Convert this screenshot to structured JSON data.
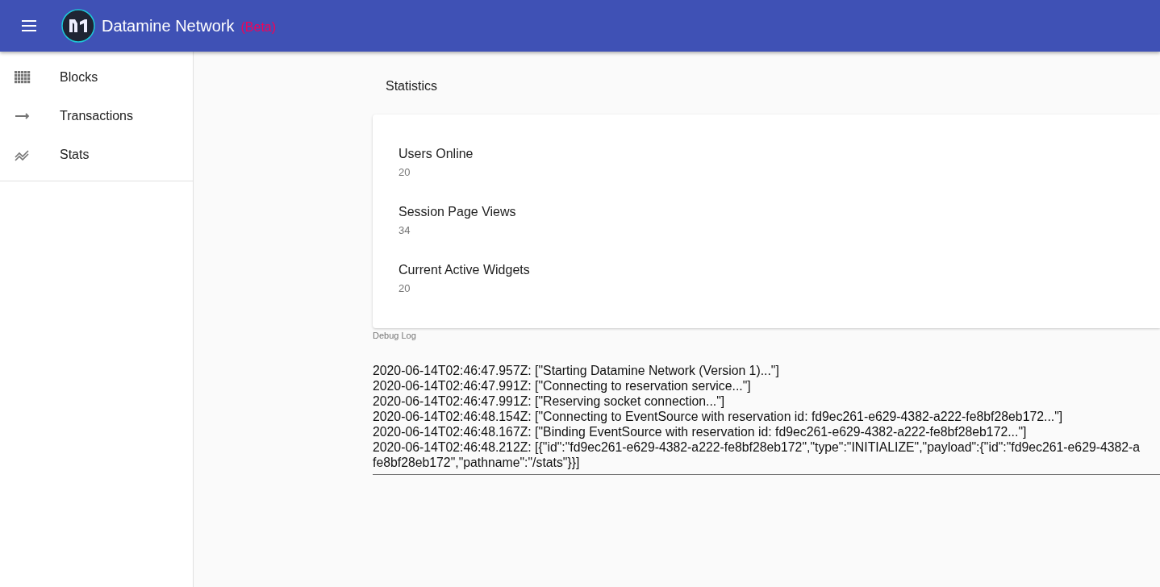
{
  "app_bar": {
    "title": "Datamine Network",
    "badge": "(Beta)"
  },
  "sidebar": {
    "items": [
      {
        "label": "Blocks",
        "kind": "grid"
      },
      {
        "label": "Transactions",
        "kind": "arrow"
      },
      {
        "label": "Stats",
        "kind": "trend"
      }
    ]
  },
  "statistics": {
    "heading": "Statistics",
    "metrics": [
      {
        "label": "Users Online",
        "value": "20"
      },
      {
        "label": "Session Page Views",
        "value": "34"
      },
      {
        "label": "Current Active Widgets",
        "value": "20"
      }
    ]
  },
  "debug_log": {
    "label": "Debug Log",
    "lines": [
      "2020-06-14T02:46:47.957Z: [\"Starting Datamine Network (Version 1)...\"]",
      "2020-06-14T02:46:47.991Z: [\"Connecting to reservation service...\"]",
      "2020-06-14T02:46:47.991Z: [\"Reserving socket connection...\"]",
      "2020-06-14T02:46:48.154Z: [\"Connecting to EventSource with reservation id: fd9ec261-e629-4382-a222-fe8bf28eb172...\"]",
      "2020-06-14T02:46:48.167Z: [\"Binding EventSource with reservation id: fd9ec261-e629-4382-a222-fe8bf28eb172...\"]",
      "2020-06-14T02:46:48.212Z: [{\"id\":\"fd9ec261-e629-4382-a222-fe8bf28eb172\",\"type\":\"INITIALIZE\",\"payload\":{\"id\":\"fd9ec261-e629-4382-a",
      "fe8bf28eb172\",\"pathname\":\"/stats\"}}]"
    ]
  }
}
